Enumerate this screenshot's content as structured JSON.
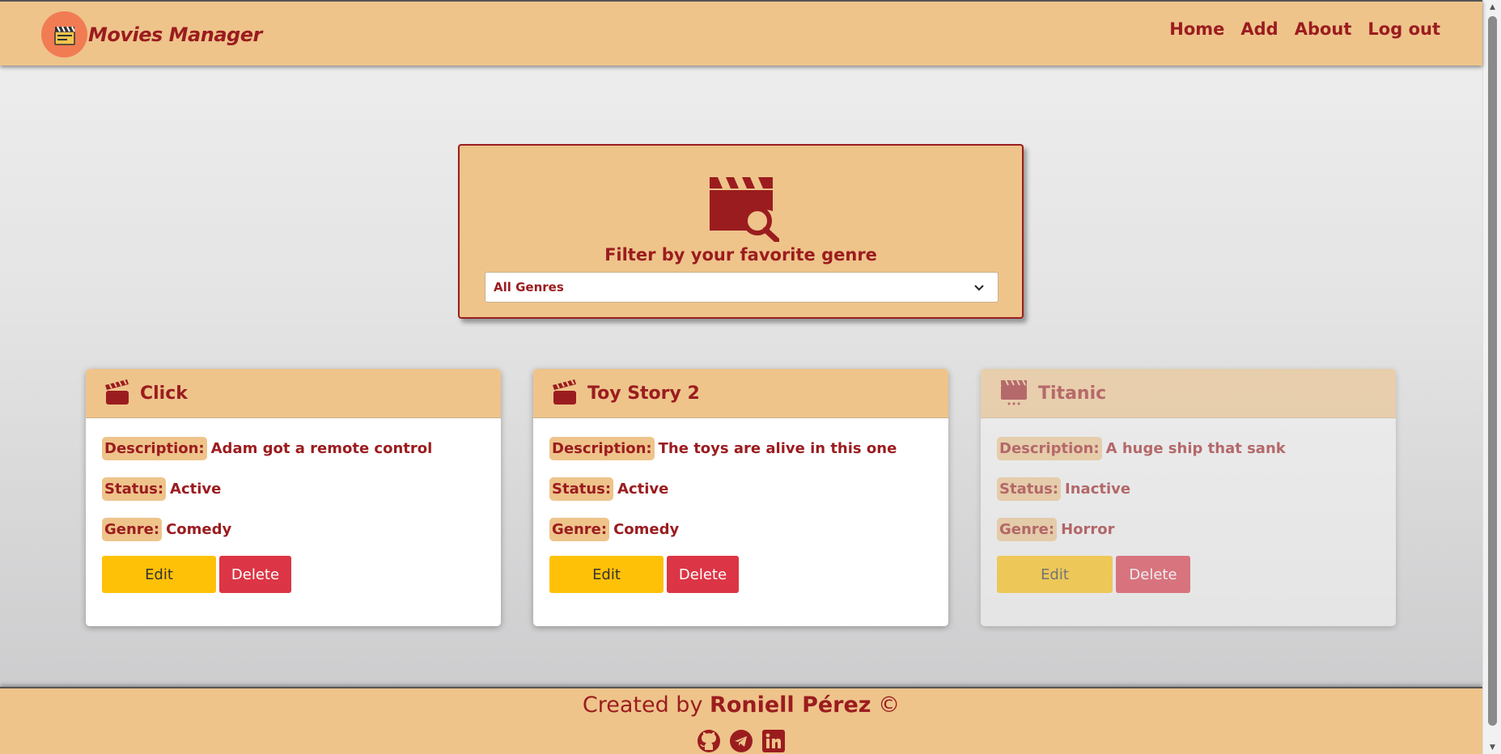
{
  "brand": {
    "title": "Movies Manager",
    "logo_icon": "clapperboard-emoji-icon"
  },
  "nav": {
    "items": [
      {
        "label": "Home"
      },
      {
        "label": "Add"
      },
      {
        "label": "About"
      },
      {
        "label": "Log out"
      }
    ]
  },
  "filter": {
    "icon": "film-search-icon",
    "title": "Filter by your favorite genre",
    "selected_genre": "All Genres"
  },
  "movies": [
    {
      "title": "Click",
      "description_label": "Description:",
      "description": "Adam got a remote control",
      "status_label": "Status:",
      "status": "Active",
      "genre_label": "Genre:",
      "genre": "Comedy",
      "edit_label": "Edit",
      "delete_label": "Delete",
      "active": true
    },
    {
      "title": "Toy Story 2",
      "description_label": "Description:",
      "description": "The toys are alive in this one",
      "status_label": "Status:",
      "status": "Active",
      "genre_label": "Genre:",
      "genre": "Comedy",
      "edit_label": "Edit",
      "delete_label": "Delete",
      "active": true
    },
    {
      "title": "Titanic",
      "description_label": "Description:",
      "description": "A huge ship that sank",
      "status_label": "Status:",
      "status": "Inactive",
      "genre_label": "Genre:",
      "genre": "Horror",
      "edit_label": "Edit",
      "delete_label": "Delete",
      "active": false
    }
  ],
  "footer": {
    "prefix": "Created by",
    "author": "Roniell Pérez",
    "suffix": "©",
    "social": [
      "github-icon",
      "telegram-icon",
      "linkedin-icon"
    ]
  },
  "colors": {
    "primary": "#9b1c1f",
    "accent_bg": "#eec48b",
    "edit_button": "#ffc107",
    "delete_button": "#dc3545"
  }
}
